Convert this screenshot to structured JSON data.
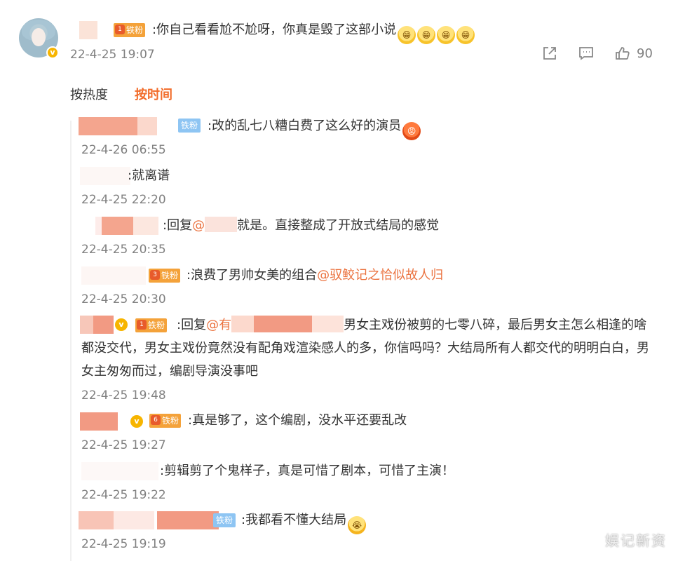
{
  "main_comment": {
    "badge": "铁粉",
    "text": ":你自己看看尬不尬呀，你真是毁了这部小说",
    "emojis": [
      "grin",
      "grin",
      "grin",
      "grin"
    ],
    "time": "22-4-25 19:07",
    "like_count": "90"
  },
  "tabs": {
    "hot": "按热度",
    "time": "按时间"
  },
  "replies": [
    {
      "badge": "铁粉",
      "text": ":改的乱七八糟白费了这么好的演员",
      "time": "22-4-26 06:55"
    },
    {
      "text": ":就离谱",
      "time": "22-4-25 22:20"
    },
    {
      "text_prefix": ":回复",
      "mention": "@",
      "text": "就是。直接整成了开放式结局的感觉",
      "time": "22-4-25 20:35"
    },
    {
      "badge": "铁粉",
      "text": ":浪费了男帅女美的组合",
      "mention": "@驭鲛记之恰似故人归",
      "time": "22-4-25 20:30"
    },
    {
      "badge": "铁粉",
      "text_prefix": ":回复",
      "mention": "@有",
      "text": "男女主戏份被剪的七零八碎，最后男女主怎么相逢的啥都没交代，男女主戏份竟然没有配角戏渲染感人的多，你信吗吗？大结局所有人都交代的明明白白，男女主匆匆而过，编剧导演没事吧",
      "time": "22-4-25 19:48"
    },
    {
      "badge": "铁粉",
      "text": ":真是够了，这个编剧，没水平还要乱改",
      "time": "22-4-25 19:27"
    },
    {
      "text": ":剪辑剪了个鬼样子，真是可惜了剧本，可惜了主演！",
      "time": "22-4-25 19:22"
    },
    {
      "badge": "铁粉",
      "text": ":我都看不懂大结局",
      "time": "22-4-25 19:19"
    }
  ],
  "watermark": "娱记新资",
  "colors": {
    "accent": "#f26c2a",
    "mention": "#eb7340",
    "badge_gold": "#f4a23a",
    "badge_blue": "#8ec5f3",
    "time_gray": "#808080"
  }
}
